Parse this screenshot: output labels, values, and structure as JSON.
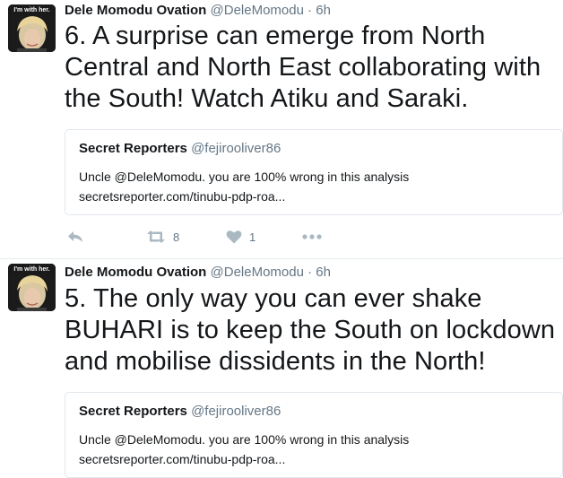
{
  "tweets": [
    {
      "avatar_banner": "I'm with her.",
      "name": "Dele Momodu Ovation",
      "handle": "@DeleMomodu",
      "separator": "·",
      "time": "6h",
      "text": "6. A surprise can emerge from North Central and North East collaborating with the South! Watch Atiku and Saraki.",
      "quote": {
        "name": "Secret Reporters",
        "handle": "@fejirooliver86",
        "line1": "Uncle @DeleMomodu. you are 100% wrong in this analysis",
        "line2": "secretsreporter.com/tinubu-pdp-roa..."
      },
      "retweets": "8",
      "likes": "1"
    },
    {
      "avatar_banner": "I'm with her.",
      "name": "Dele Momodu Ovation",
      "handle": "@DeleMomodu",
      "separator": "·",
      "time": "6h",
      "text": "5. The only way you can ever shake BUHARI is to keep the South on lockdown and mobilise dissidents in the North!",
      "quote": {
        "name": "Secret Reporters",
        "handle": "@fejirooliver86",
        "line1": "Uncle @DeleMomodu. you are 100% wrong in this analysis",
        "line2": "secretsreporter.com/tinubu-pdp-roa..."
      }
    }
  ],
  "icons": {
    "reply": "reply-icon",
    "retweet": "retweet-icon",
    "like": "heart-icon",
    "more": "more-icon"
  },
  "colors": {
    "text": "#14171a",
    "muted": "#657786",
    "icon": "#aab8c2",
    "border": "#e1e8ed"
  }
}
